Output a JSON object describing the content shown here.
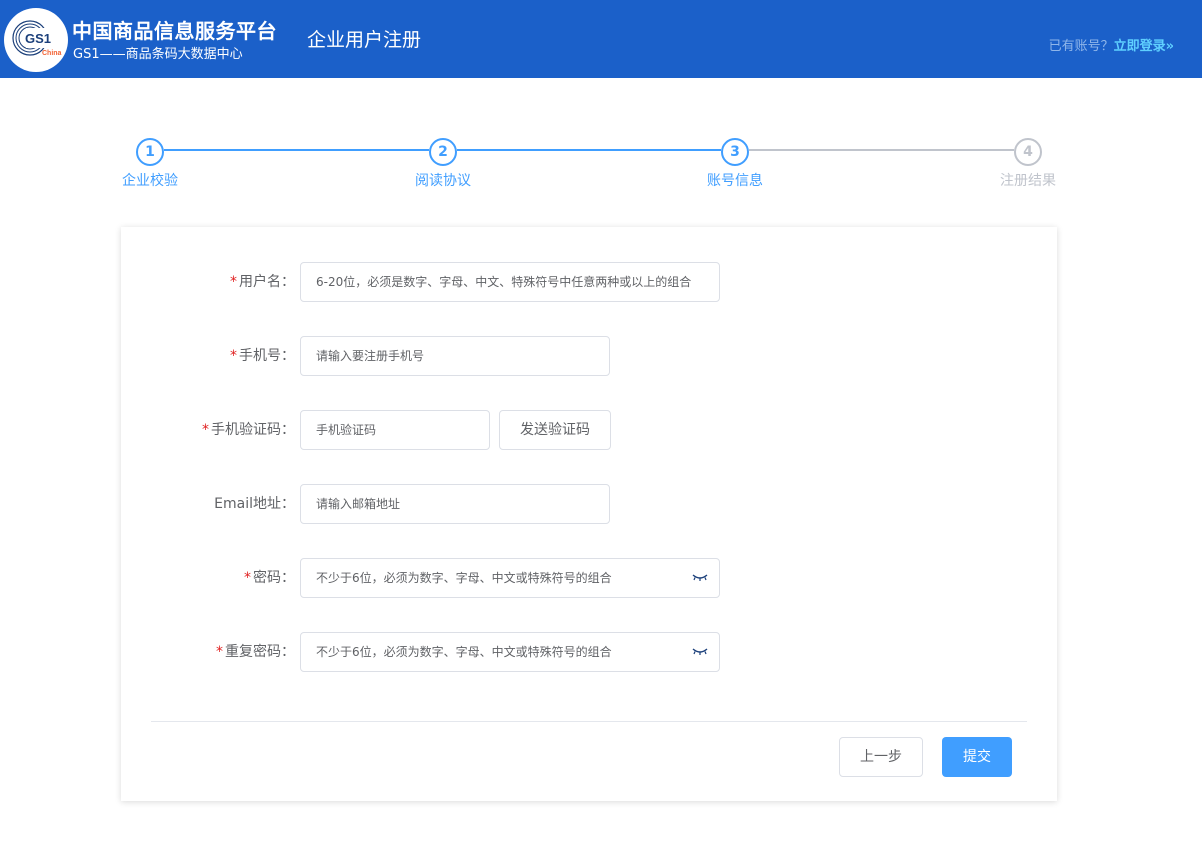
{
  "header": {
    "logo_text": "GS1",
    "logo_sub": "China",
    "brand_title": "中国商品信息服务平台",
    "brand_subtitle": "GS1——商品条码大数据中心",
    "page_title": "企业用户注册",
    "login_prompt": "已有账号？",
    "login_link": "立即登录»"
  },
  "steps": [
    {
      "number": "1",
      "label": "企业校验",
      "active": true
    },
    {
      "number": "2",
      "label": "阅读协议",
      "active": true
    },
    {
      "number": "3",
      "label": "账号信息",
      "active": true
    },
    {
      "number": "4",
      "label": "注册结果",
      "active": false
    }
  ],
  "form": {
    "username": {
      "required_mark": "*",
      "label": "用户名：",
      "placeholder": "6-20位，必须是数字、字母、中文、特殊符号中任意两种或以上的组合"
    },
    "phone": {
      "required_mark": "*",
      "label": "手机号：",
      "placeholder": "请输入要注册手机号"
    },
    "sms_code": {
      "required_mark": "*",
      "label": "手机验证码：",
      "placeholder": "手机验证码",
      "send_button": "发送验证码"
    },
    "email": {
      "label": "Email地址：",
      "placeholder": "请输入邮箱地址"
    },
    "password": {
      "required_mark": "*",
      "label": "密码：",
      "placeholder": "不少于6位，必须为数字、字母、中文或特殊符号的组合"
    },
    "confirm_password": {
      "required_mark": "*",
      "label": "重复密码：",
      "placeholder": "不少于6位，必须为数字、字母、中文或特殊符号的组合"
    }
  },
  "actions": {
    "prev": "上一步",
    "submit": "提交"
  },
  "colors": {
    "header_bg": "#1b60c9",
    "primary": "#409eff",
    "inactive": "#c0c4cc",
    "required": "#e02020"
  }
}
